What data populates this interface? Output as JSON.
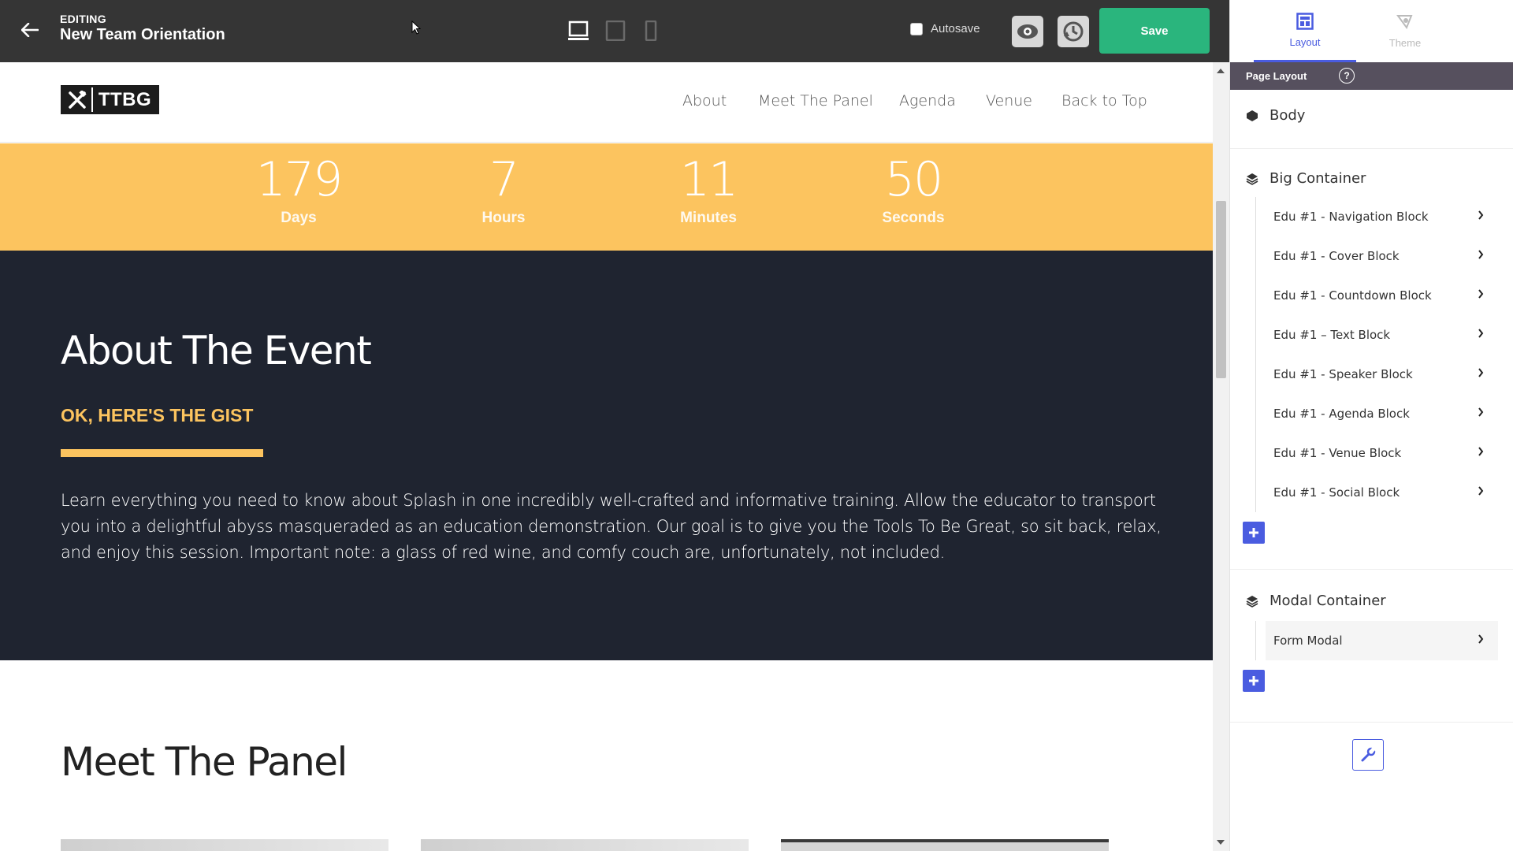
{
  "topbar": {
    "editing_label": "EDITING",
    "title": "New Team Orientation",
    "autosave_label": "Autosave",
    "save_label": "Save"
  },
  "site": {
    "logo_text": "TTBG",
    "nav": [
      "About",
      "Meet The Panel",
      "Agenda",
      "Venue",
      "Back to Top"
    ],
    "countdown": [
      {
        "value": "179",
        "label": "Days"
      },
      {
        "value": "7",
        "label": "Hours"
      },
      {
        "value": "11",
        "label": "Minutes"
      },
      {
        "value": "50",
        "label": "Seconds"
      }
    ],
    "about": {
      "title": "About The Event",
      "subtitle": "OK, HERE'S THE GIST",
      "body": "Learn everything you need to know about Splash in one incredibly well-crafted and informative training. Allow the educator to transport you into a delightful abyss masqueraded as an education demonstration. Our goal is to give you the Tools To Be Great, so sit back, relax, and enjoy this session. Important note: a glass of red wine, and comfy couch are, unfortunately, not included."
    },
    "panel": {
      "title": "Meet The Panel"
    }
  },
  "sidebar": {
    "tabs": [
      {
        "label": "Layout"
      },
      {
        "label": "Theme"
      }
    ],
    "page_layout_label": "Page Layout",
    "help_glyph": "?",
    "body_label": "Body",
    "big_container": {
      "label": "Big Container",
      "items": [
        "Edu #1 - Navigation Block",
        "Edu #1 - Cover Block",
        "Edu #1 - Countdown Block",
        "Edu #1 – Text Block",
        "Edu #1 - Speaker Block",
        "Edu #1 - Agenda Block",
        "Edu #1 - Venue Block",
        "Edu #1 - Social Block"
      ]
    },
    "modal_container": {
      "label": "Modal Container",
      "items": [
        "Form Modal"
      ]
    }
  },
  "colors": {
    "accent": "#4a5ce0",
    "save": "#2ab57d",
    "countdown_bg": "#fcc45f",
    "dark_bg": "#1f2430"
  }
}
